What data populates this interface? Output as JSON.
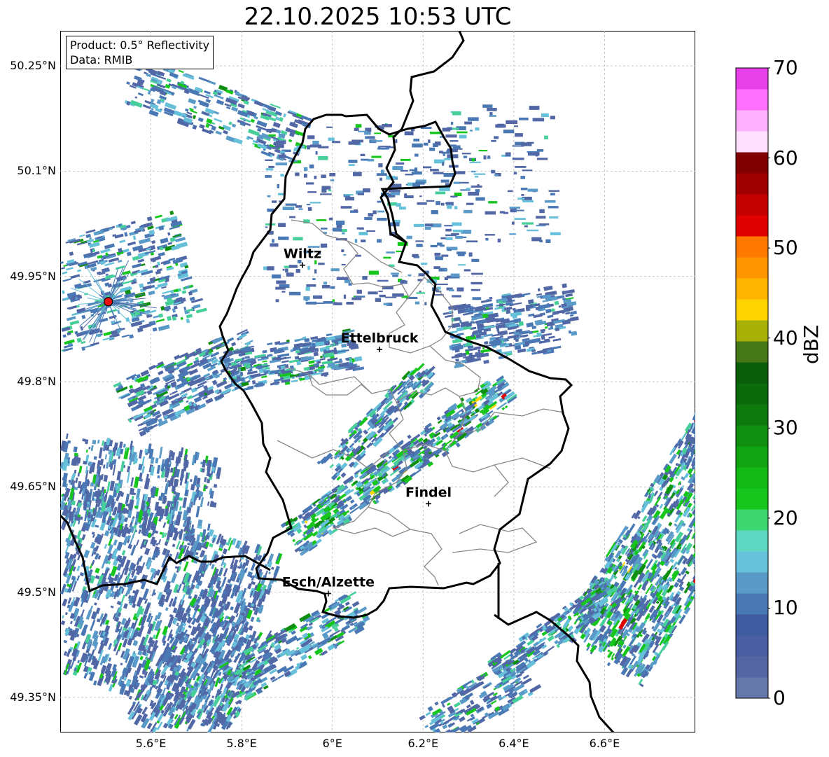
{
  "title": "22.10.2025 10:53 UTC",
  "info": {
    "product": "Product: 0.5° Reflectivity",
    "data": "Data: RMIB"
  },
  "axes": {
    "lat_ticks": [
      {
        "value": 50.25,
        "label": "50.25°N"
      },
      {
        "value": 50.1,
        "label": "50.1°N"
      },
      {
        "value": 49.95,
        "label": "49.95°N"
      },
      {
        "value": 49.8,
        "label": "49.8°N"
      },
      {
        "value": 49.65,
        "label": "49.65°N"
      },
      {
        "value": 49.5,
        "label": "49.5°N"
      },
      {
        "value": 49.35,
        "label": "49.35°N"
      }
    ],
    "lon_ticks": [
      {
        "value": 5.6,
        "label": "5.6°E"
      },
      {
        "value": 5.8,
        "label": "5.8°E"
      },
      {
        "value": 6.0,
        "label": "6°E"
      },
      {
        "value": 6.2,
        "label": "6.2°E"
      },
      {
        "value": 6.4,
        "label": "6.4°E"
      },
      {
        "value": 6.6,
        "label": "6.6°E"
      }
    ],
    "lon_range": [
      5.4,
      6.8
    ],
    "lat_range": [
      49.3,
      50.3
    ]
  },
  "cities": [
    {
      "name": "Wiltz",
      "lon": 5.934,
      "lat": 49.966
    },
    {
      "name": "Ettelbruck",
      "lon": 6.104,
      "lat": 49.846
    },
    {
      "name": "Findel",
      "lon": 6.212,
      "lat": 49.626
    },
    {
      "name": "Esch/Alzette",
      "lon": 5.991,
      "lat": 49.498
    }
  ],
  "radar_site": {
    "lon": 5.506,
    "lat": 49.914
  },
  "colorbar": {
    "label": "dBZ",
    "min": 0,
    "max": 70,
    "ticks": [
      "0",
      "10",
      "20",
      "30",
      "40",
      "50",
      "60",
      "70"
    ],
    "colors": [
      "#6677aa",
      "#5566a5",
      "#4a5fa3",
      "#3f5aa0",
      "#4a78b4",
      "#5a9ac8",
      "#68c2dc",
      "#5ed8c2",
      "#3ed66e",
      "#16c61c",
      "#12b814",
      "#10a412",
      "#0f8e0f",
      "#0c7a0c",
      "#0b6a0b",
      "#0a5e0a",
      "#477818",
      "#a6b007",
      "#ffd400",
      "#ffb400",
      "#ff9600",
      "#ff7800",
      "#e00000",
      "#c40000",
      "#a00000",
      "#800000",
      "#ffe0ff",
      "#ffb0ff",
      "#ff70ff",
      "#e840e8"
    ]
  },
  "echo_palette": [
    "#5267a6",
    "#4a78b4",
    "#5a9ac8",
    "#66c0d9",
    "#47cf9a",
    "#16c61c",
    "#0f8e0f",
    "#ffd400",
    "#e00000"
  ]
}
